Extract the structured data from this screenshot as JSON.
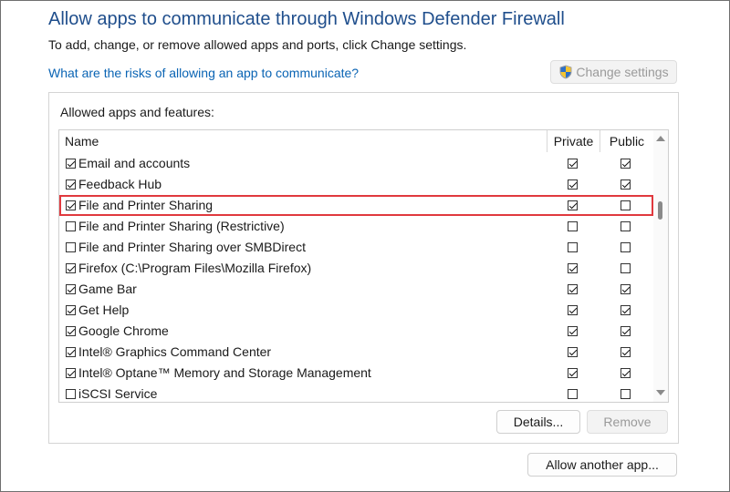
{
  "window": {
    "title": "Allow apps to communicate through Windows Defender Firewall",
    "subtitle": "To add, change, or remove allowed apps and ports, click Change settings.",
    "risk_link": "What are the risks of allowing an app to communicate?",
    "change_settings_label": "Change settings"
  },
  "group": {
    "label": "Allowed apps and features:",
    "columns": {
      "name": "Name",
      "private": "Private",
      "public": "Public"
    },
    "apps": [
      {
        "name": "Email and accounts",
        "enabled": true,
        "private": true,
        "public": true
      },
      {
        "name": "Feedback Hub",
        "enabled": true,
        "private": true,
        "public": true
      },
      {
        "name": "File and Printer Sharing",
        "enabled": true,
        "private": true,
        "public": false,
        "selected": true
      },
      {
        "name": "File and Printer Sharing (Restrictive)",
        "enabled": false,
        "private": false,
        "public": false
      },
      {
        "name": "File and Printer Sharing over SMBDirect",
        "enabled": false,
        "private": false,
        "public": false
      },
      {
        "name": "Firefox (C:\\Program Files\\Mozilla Firefox)",
        "enabled": true,
        "private": true,
        "public": false
      },
      {
        "name": "Game Bar",
        "enabled": true,
        "private": true,
        "public": true
      },
      {
        "name": "Get Help",
        "enabled": true,
        "private": true,
        "public": true
      },
      {
        "name": "Google Chrome",
        "enabled": true,
        "private": true,
        "public": true
      },
      {
        "name": "Intel® Graphics Command Center",
        "enabled": true,
        "private": true,
        "public": true
      },
      {
        "name": "Intel® Optane™ Memory and Storage Management",
        "enabled": true,
        "private": true,
        "public": true
      },
      {
        "name": "iSCSI Service",
        "enabled": false,
        "private": false,
        "public": false
      }
    ],
    "details_label": "Details...",
    "remove_label": "Remove"
  },
  "allow_another_label": "Allow another app...",
  "colors": {
    "title": "#1f4e8c",
    "link": "#0a64b4",
    "highlight": "#e0393e"
  },
  "icons": {
    "change_settings": "uac-shield-icon"
  }
}
